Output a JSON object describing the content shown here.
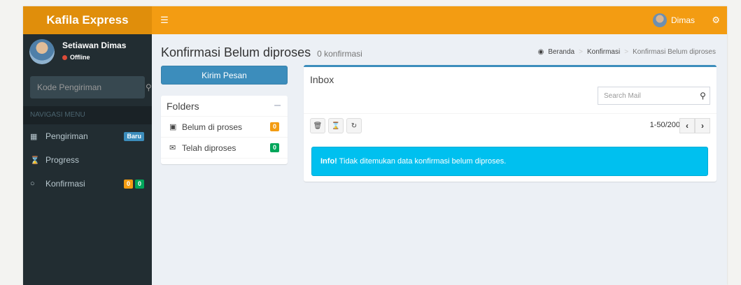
{
  "header": {
    "brand": "Kafila Express",
    "menu_toggle_icon": "hamburger-icon",
    "user_name": "Dimas",
    "settings_icon": "gears-icon"
  },
  "sidebar": {
    "user": {
      "name": "Setiawan Dimas",
      "status": "Offline"
    },
    "search": {
      "placeholder": "Kode Pengiriman",
      "icon": "search-icon"
    },
    "nav_header": "NAVIGASI MENU",
    "items": [
      {
        "label": "Pengiriman",
        "icon": "th-large-icon",
        "badges": [
          "Baru"
        ]
      },
      {
        "label": "Progress",
        "icon": "hourglass-icon",
        "badges": []
      },
      {
        "label": "Konfirmasi",
        "icon": "comment-icon",
        "badges": [
          "0",
          "0"
        ]
      }
    ]
  },
  "content": {
    "title": "Konfirmasi Belum diproses",
    "subtitle": "0 konfirmasi",
    "breadcrumb": [
      "Beranda",
      "Konfirmasi",
      "Konfirmasi Belum diproses"
    ],
    "compose_label": "Kirim Pesan",
    "folders": {
      "title": "Folders",
      "items": [
        {
          "label": "Belum di proses",
          "icon": "inbox-icon",
          "count": "0"
        },
        {
          "label": "Telah diproses",
          "icon": "envelope-icon",
          "count": "0"
        }
      ]
    },
    "inbox": {
      "title": "Inbox",
      "search_placeholder": "Search Mail",
      "pager": "1-50/200",
      "alert_strong": "Info!",
      "alert_text": " Tidak ditemukan data konfirmasi belum diproses."
    }
  },
  "colors": {
    "header": "#f39c12",
    "logo": "#e08e0b",
    "sidebar": "#222d32",
    "primary": "#3c8dbc",
    "info": "#00c0ef",
    "badge_orange": "#f39c12",
    "badge_green": "#00a65a"
  }
}
